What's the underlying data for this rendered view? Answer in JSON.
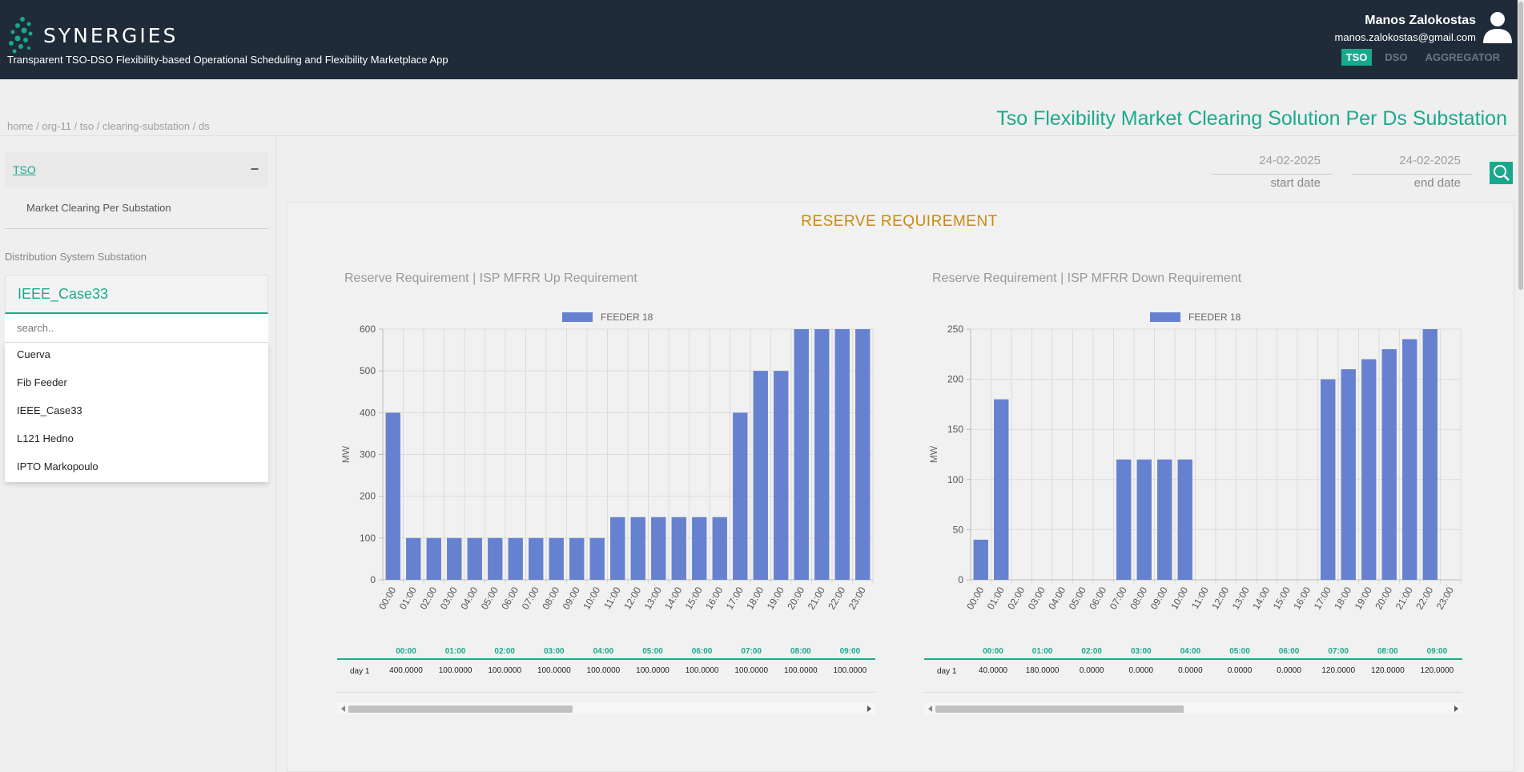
{
  "header": {
    "brand": "SYNERGIES",
    "subtitle": "Transparent TSO-DSO Flexibility-based Operational Scheduling and Flexibility Marketplace App",
    "user_name": "Manos Zalokostas",
    "user_email": "manos.zalokostas@gmail.com",
    "roles": [
      "TSO",
      "DSO",
      "AGGREGATOR"
    ],
    "active_role": "TSO",
    "brand_color": "#17a98b"
  },
  "breadcrumb": "home / org-11 / tso / clearing-substation / ds",
  "page_title": "Tso Flexibility Market Clearing Solution Per Ds Substation",
  "sidebar": {
    "section": "TSO",
    "collapse_symbol": "–",
    "menu_item": "Market Clearing Per Substation",
    "dss_label": "Distribution System Substation",
    "selected": "IEEE_Case33",
    "search_placeholder": "search..",
    "options": [
      "Cuerva",
      "Fib Feeder",
      "IEEE_Case33",
      "L121 Hedno",
      "IPTO Markopoulo"
    ]
  },
  "filters": {
    "start_date": "24-02-2025",
    "start_label": "start date",
    "end_date": "24-02-2025",
    "end_label": "end date"
  },
  "section_title": "RESERVE REQUIREMENT",
  "chart_data": [
    {
      "type": "bar",
      "title": "Reserve Requirement | ISP MFRR Up Requirement",
      "ylabel": "MW",
      "ylim": [
        0,
        600
      ],
      "yticks": [
        0,
        100,
        200,
        300,
        400,
        500,
        600
      ],
      "categories": [
        "00:00",
        "01:00",
        "02:00",
        "03:00",
        "04:00",
        "05:00",
        "06:00",
        "07:00",
        "08:00",
        "09:00",
        "10:00",
        "11:00",
        "12:00",
        "13:00",
        "14:00",
        "15:00",
        "16:00",
        "17:00",
        "18:00",
        "19:00",
        "20:00",
        "21:00",
        "22:00",
        "23:00"
      ],
      "series": [
        {
          "name": "FEEDER 18",
          "values": [
            400,
            100,
            100,
            100,
            100,
            100,
            100,
            100,
            100,
            100,
            100,
            150,
            150,
            150,
            150,
            150,
            150,
            400,
            500,
            500,
            600,
            600,
            600,
            600
          ],
          "color": "#6581d0"
        }
      ],
      "legend": "top-center",
      "grid": true
    },
    {
      "type": "bar",
      "title": "Reserve Requirement | ISP MFRR Down Requirement",
      "ylabel": "MW",
      "ylim": [
        0,
        250
      ],
      "yticks": [
        0,
        50,
        100,
        150,
        200,
        250
      ],
      "categories": [
        "00:00",
        "01:00",
        "02:00",
        "03:00",
        "04:00",
        "05:00",
        "06:00",
        "07:00",
        "08:00",
        "09:00",
        "10:00",
        "11:00",
        "12:00",
        "13:00",
        "14:00",
        "15:00",
        "16:00",
        "17:00",
        "18:00",
        "19:00",
        "20:00",
        "21:00",
        "22:00",
        "23:00"
      ],
      "series": [
        {
          "name": "FEEDER 18",
          "values": [
            40,
            180,
            0,
            0,
            0,
            0,
            0,
            120,
            120,
            120,
            120,
            0,
            0,
            0,
            0,
            0,
            0,
            200,
            210,
            220,
            230,
            240,
            250,
            0
          ],
          "color": "#6581d0"
        }
      ],
      "legend": "top-center",
      "grid": true
    }
  ],
  "tables": [
    {
      "row_label": "day 1",
      "headers": [
        "00:00",
        "01:00",
        "02:00",
        "03:00",
        "04:00",
        "05:00",
        "06:00",
        "07:00",
        "08:00",
        "09:00"
      ],
      "values": [
        "400.0000",
        "100.0000",
        "100.0000",
        "100.0000",
        "100.0000",
        "100.0000",
        "100.0000",
        "100.0000",
        "100.0000",
        "100.0000"
      ]
    },
    {
      "row_label": "day 1",
      "headers": [
        "00:00",
        "01:00",
        "02:00",
        "03:00",
        "04:00",
        "05:00",
        "06:00",
        "07:00",
        "08:00",
        "09:00",
        "10:00"
      ],
      "values": [
        "40.0000",
        "180.0000",
        "0.0000",
        "0.0000",
        "0.0000",
        "0.0000",
        "0.0000",
        "120.0000",
        "120.0000",
        "120.0000",
        "120.0000"
      ]
    }
  ]
}
